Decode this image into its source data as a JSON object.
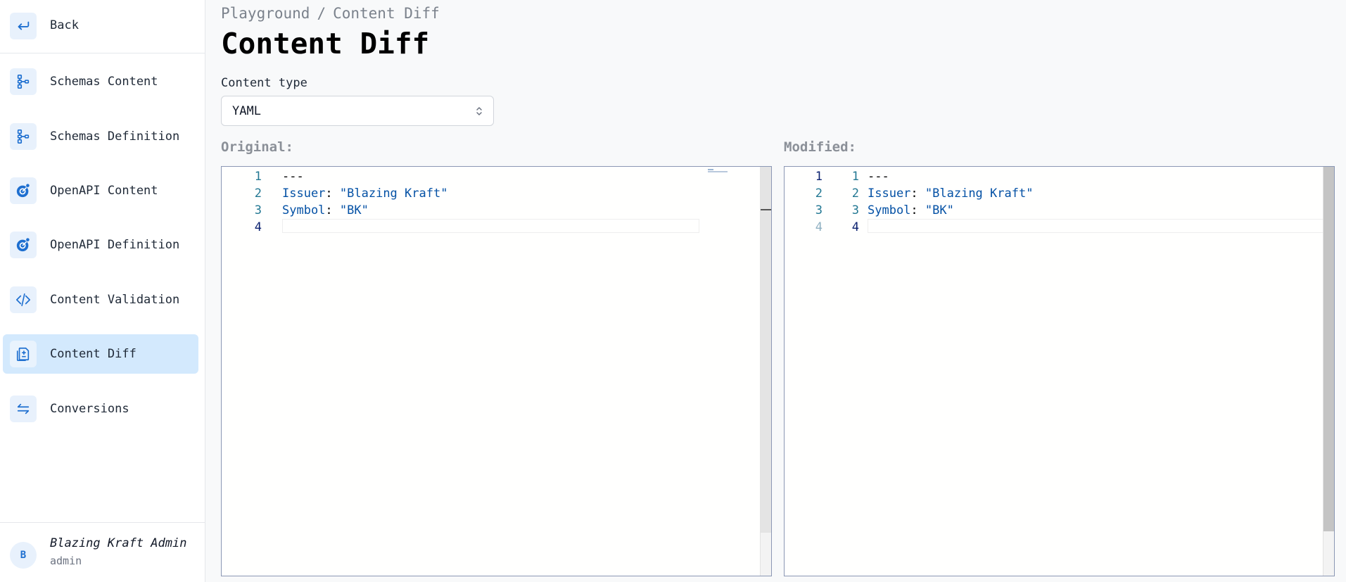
{
  "sidebar": {
    "back_label": "Back",
    "items": [
      {
        "label": "Schemas Content",
        "icon": "schema-tree-icon"
      },
      {
        "label": "Schemas Definition",
        "icon": "schema-tree-icon"
      },
      {
        "label": "OpenAPI Content",
        "icon": "openapi-icon"
      },
      {
        "label": "OpenAPI Definition",
        "icon": "openapi-icon"
      },
      {
        "label": "Content Validation",
        "icon": "code-icon"
      },
      {
        "label": "Content Diff",
        "icon": "diff-document-icon",
        "active": true
      },
      {
        "label": "Conversions",
        "icon": "swap-arrows-icon"
      }
    ],
    "user": {
      "initial": "B",
      "name": "Blazing Kraft Admin",
      "role": "admin"
    }
  },
  "breadcrumb": {
    "parent": "Playground",
    "separator": "/",
    "current": "Content Diff"
  },
  "page_title": "Content Diff",
  "content_type": {
    "label": "Content type",
    "value": "YAML"
  },
  "original": {
    "label": "Original:",
    "line_numbers": [
      "1",
      "2",
      "3",
      "4"
    ],
    "lines": [
      {
        "plain": "---"
      },
      {
        "key": "Issuer",
        "sep": ": ",
        "value": "\"Blazing Kraft\""
      },
      {
        "key": "Symbol",
        "sep": ": ",
        "value": "\"BK\""
      },
      {
        "plain": ""
      }
    ]
  },
  "modified": {
    "label": "Modified:",
    "original_line_numbers": [
      "1",
      "2",
      "3",
      "4"
    ],
    "line_numbers": [
      "1",
      "2",
      "3",
      "4"
    ],
    "lines": [
      {
        "plain": "---"
      },
      {
        "key": "Issuer",
        "sep": ": ",
        "value": "\"Blazing Kraft\""
      },
      {
        "key": "Symbol",
        "sep": ": ",
        "value": "\"BK\""
      },
      {
        "plain": ""
      }
    ]
  },
  "colors": {
    "accent": "#1e6fd0",
    "active_bg": "#d3e9fd",
    "token": "#0451a5"
  }
}
